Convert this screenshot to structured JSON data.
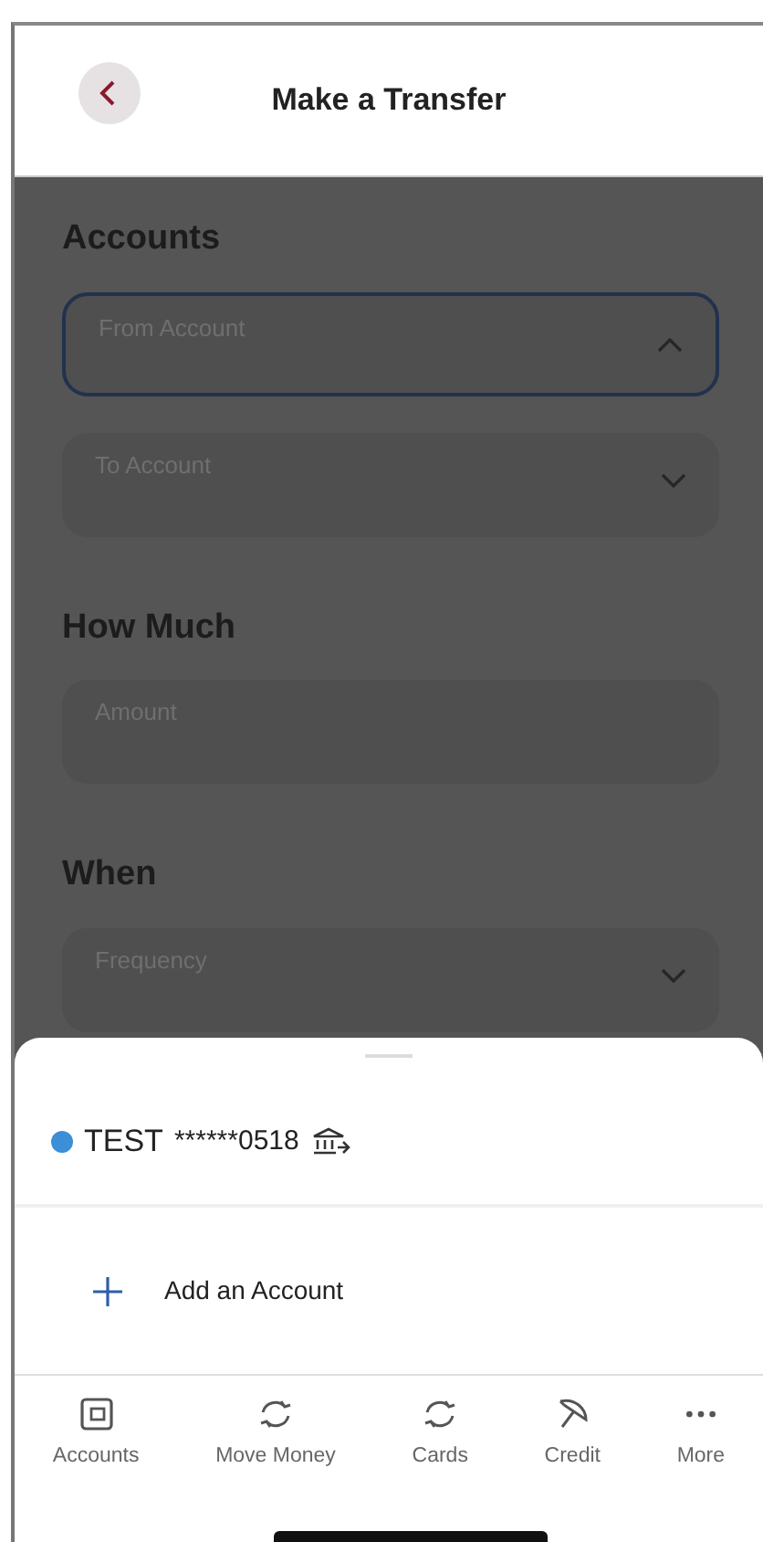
{
  "header": {
    "title": "Make a Transfer"
  },
  "sections": [
    {
      "heading": "Accounts",
      "fields": [
        {
          "kind": "select",
          "label": "From Account",
          "expanded": true
        },
        {
          "kind": "select",
          "label": "To Account",
          "expanded": false
        }
      ]
    },
    {
      "heading": "How Much",
      "fields": [
        {
          "kind": "input",
          "placeholder": "Amount"
        }
      ]
    },
    {
      "heading": "When",
      "fields": [
        {
          "kind": "select",
          "label": "Frequency",
          "expanded": false
        }
      ]
    }
  ],
  "sheet": {
    "accounts": [
      {
        "name": "TEST",
        "number": "******0518",
        "color": "#3a8fd6"
      }
    ],
    "add_action": {
      "label": "Add an Account"
    }
  },
  "tab_bar": [
    {
      "kind": "wallet",
      "label": "Accounts"
    },
    {
      "kind": "transfer",
      "label": "Move Money"
    },
    {
      "kind": "transfer",
      "label": "Cards"
    },
    {
      "kind": "credit",
      "label": "Credit"
    },
    {
      "kind": "more",
      "label": "More"
    }
  ]
}
